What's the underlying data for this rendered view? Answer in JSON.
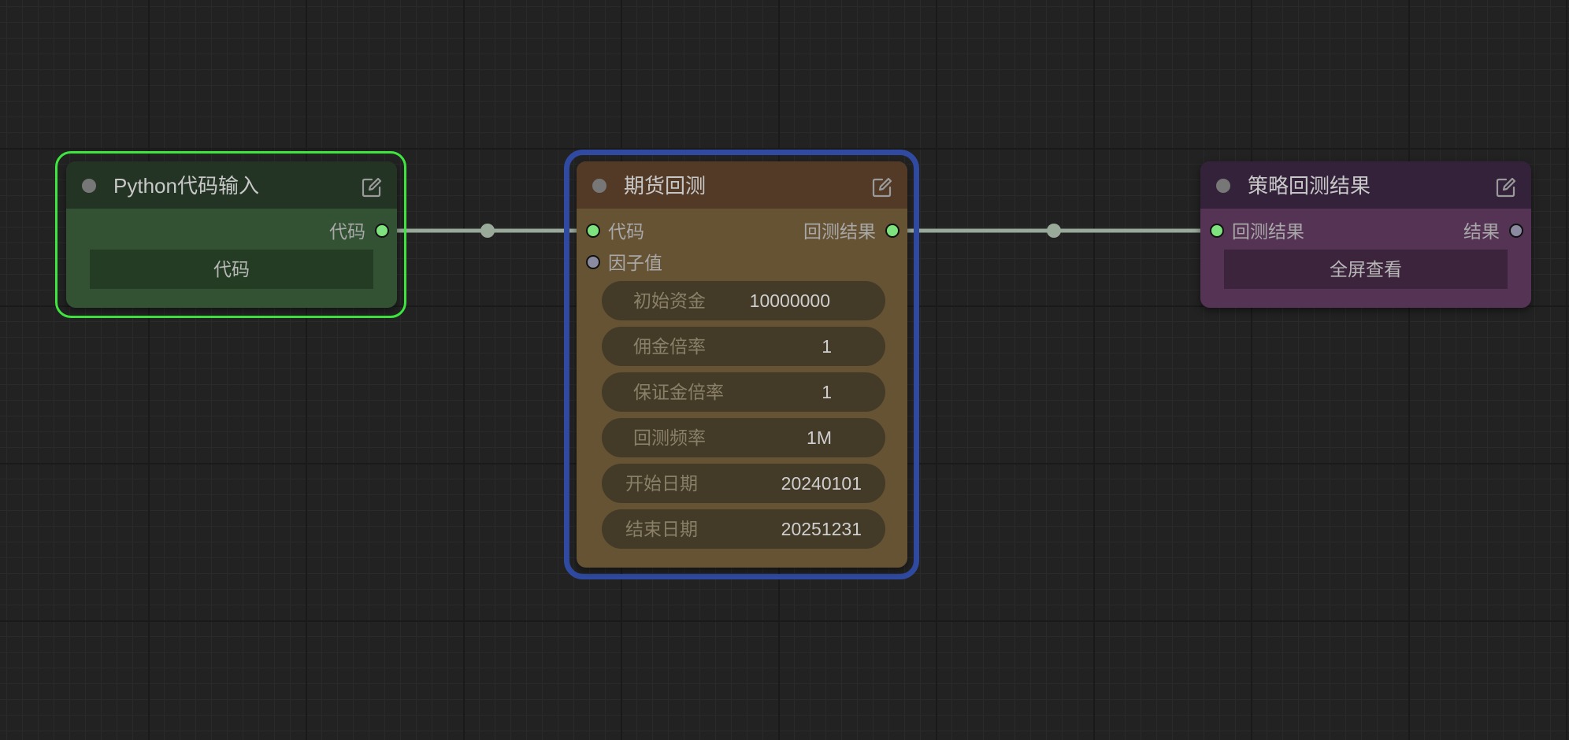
{
  "nodes": {
    "python_input": {
      "title": "Python代码输入",
      "outputs": [
        "代码"
      ],
      "button_label": "代码",
      "header_color": "#233324",
      "body_color": "#335233",
      "selection_color": "#3fe63f"
    },
    "futures_backtest": {
      "title": "期货回测",
      "inputs": [
        "代码",
        "因子值"
      ],
      "outputs": [
        "回测结果"
      ],
      "fields": [
        {
          "label": "初始资金",
          "value": "10000000"
        },
        {
          "label": "佣金倍率",
          "value": "1"
        },
        {
          "label": "保证金倍率",
          "value": "1"
        },
        {
          "label": "回测频率",
          "value": "1M"
        },
        {
          "label": "开始日期",
          "value": "20240101"
        },
        {
          "label": "结束日期",
          "value": "20251231"
        }
      ],
      "header_color": "#533a26",
      "body_color": "#665334",
      "selection_color": "#2f4aa0"
    },
    "strategy_result": {
      "title": "策略回测结果",
      "inputs": [
        "回测结果"
      ],
      "outputs": [
        "结果"
      ],
      "button_label": "全屏查看",
      "header_color": "#33223a",
      "body_color": "#553355"
    }
  },
  "colors": {
    "canvas_bg": "#222222",
    "link": "#9aaa9a",
    "socket_connected": "#7ee27e",
    "socket_unconnected": "#8a8aa0"
  },
  "icons": {
    "edit": "edit-icon",
    "collapse": "collapse-dot"
  }
}
